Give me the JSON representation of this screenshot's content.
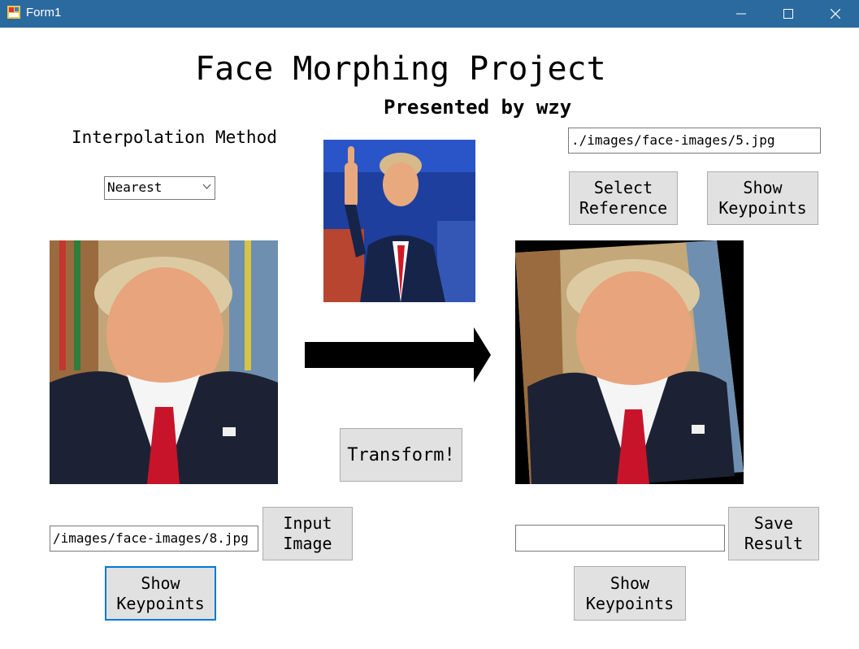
{
  "window": {
    "title": "Form1"
  },
  "header": {
    "title": "Face Morphing Project",
    "subtitle": "Presented by wzy"
  },
  "interpolation": {
    "label": "Interpolation Method",
    "selected": "Nearest"
  },
  "reference": {
    "path": "./images/face-images/5.jpg",
    "select_label": "Select\nReference",
    "show_keypoints_label": "Show\nKeypoints"
  },
  "input": {
    "path": "/images/face-images/8.jpg",
    "input_image_label": "Input\nImage",
    "show_keypoints_label": "Show\nKeypoints"
  },
  "transform": {
    "label": "Transform!"
  },
  "output": {
    "path": "",
    "save_label": "Save\nResult",
    "show_keypoints_label": "Show\nKeypoints"
  },
  "icons": [
    "app-icon",
    "minimize-icon",
    "maximize-icon",
    "close-icon",
    "chevron-down-icon",
    "arrow-right-icon"
  ]
}
